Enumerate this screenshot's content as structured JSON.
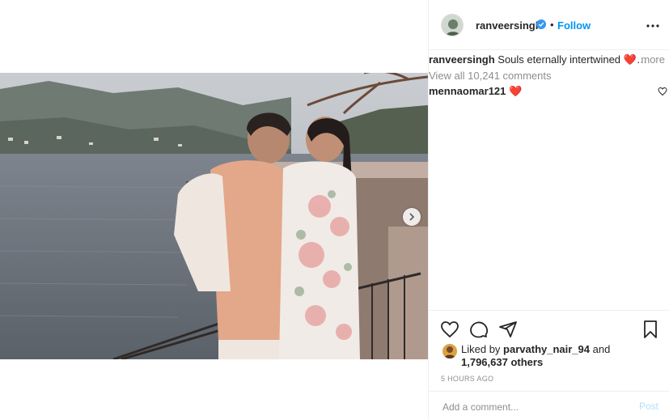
{
  "post": {
    "username": "ranveersingh",
    "follow_label": "Follow",
    "separator": "•",
    "verified_icon": "verified-badge-icon",
    "accent_color": "#0095f6",
    "more_icon": "more-options-icon"
  },
  "caption": {
    "username": "ranveersingh",
    "text": "Souls eternally intertwined",
    "emoji": "❤️",
    "trailing_glyph": "⁨⁩…",
    "more_label": "more"
  },
  "comments": {
    "view_all_label": "View all 10,241 comments",
    "items": [
      {
        "username": "mennaomar121",
        "text": "❤️"
      }
    ]
  },
  "actions": {
    "icons": [
      "like-icon",
      "comment-icon",
      "share-icon",
      "save-icon"
    ]
  },
  "likes": {
    "prefix": "Liked by",
    "user": "parvathy_nair_94",
    "conjunction": "and",
    "count": "1,796,637 others"
  },
  "timestamp": "5 HOURS AGO",
  "add_comment": {
    "placeholder": "Add a comment...",
    "post_label": "Post"
  },
  "carousel": {
    "next_icon": "chevron-right-icon"
  }
}
